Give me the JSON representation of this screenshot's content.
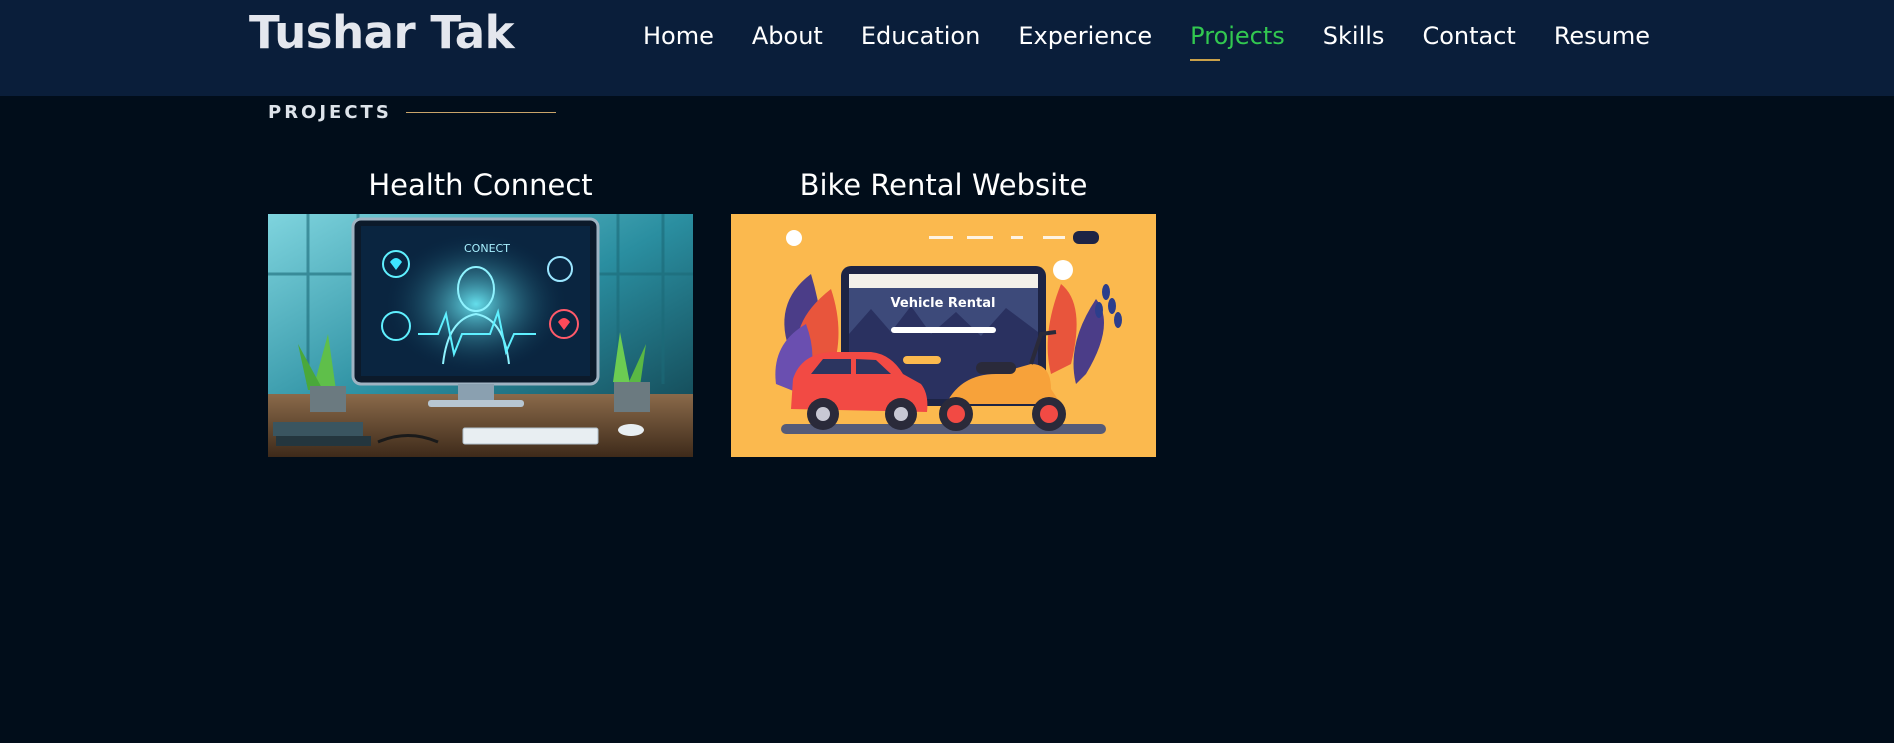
{
  "header": {
    "logo": "Tushar Tak",
    "nav": [
      {
        "label": "Home",
        "active": false
      },
      {
        "label": "About",
        "active": false
      },
      {
        "label": "Education",
        "active": false
      },
      {
        "label": "Experience",
        "active": false
      },
      {
        "label": "Projects",
        "active": true
      },
      {
        "label": "Skills",
        "active": false
      },
      {
        "label": "Contact",
        "active": false
      },
      {
        "label": "Resume",
        "active": false
      }
    ]
  },
  "section": {
    "label": "PROJECTS"
  },
  "projects": [
    {
      "title": "Health Connect",
      "image": {
        "screen_title": "CONECT"
      }
    },
    {
      "title": "Bike Rental Website",
      "image": {
        "headline": "Vehicle Rental"
      }
    }
  ],
  "colors": {
    "page_bg": "#010d1a",
    "header_bg": "#0a1e3a",
    "active_nav": "#32c850",
    "accent_gold": "#c9a14a"
  }
}
